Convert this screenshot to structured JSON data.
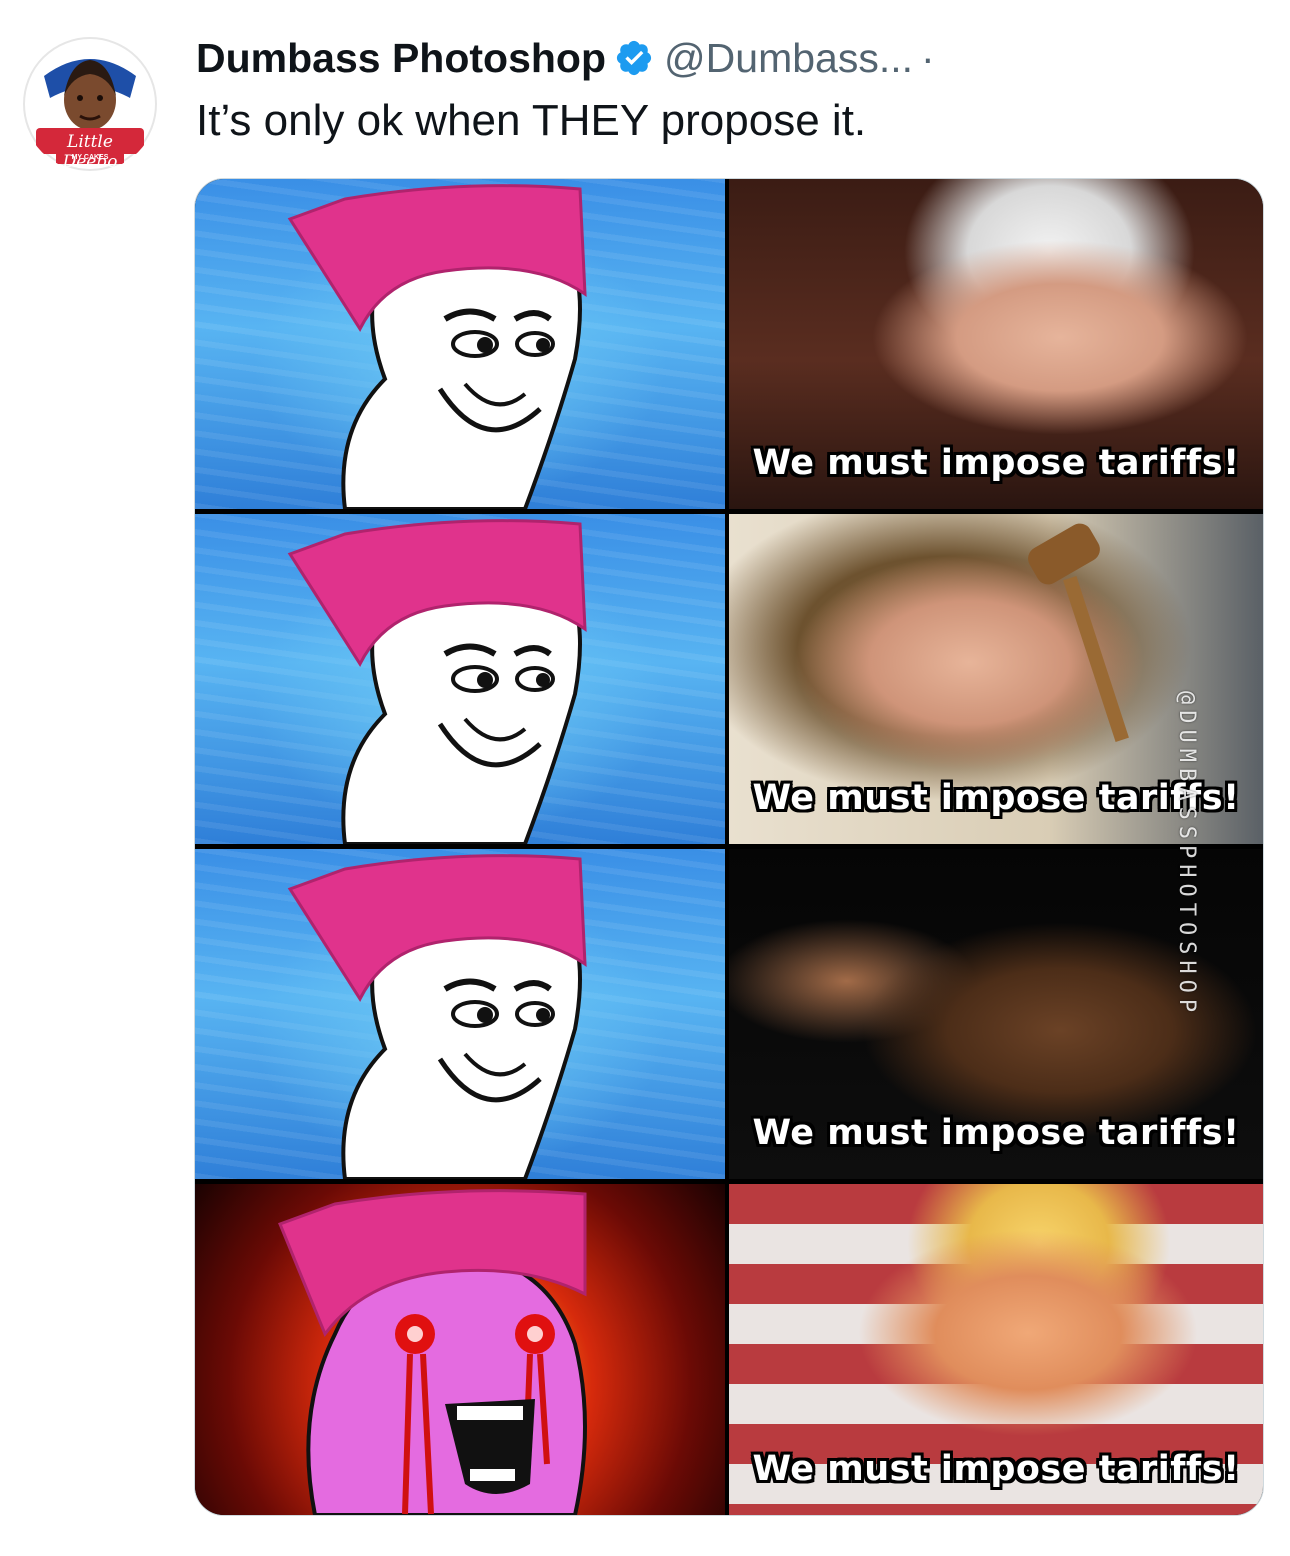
{
  "tweet": {
    "author_name": "Dumbass Photoshop",
    "handle": "@Dumbass...",
    "separator": "·",
    "text": "It’s only ok when THEY propose it.",
    "avatar_label": "Little Deebo",
    "avatar_sublabel": "MY CAKES"
  },
  "meme": {
    "watermark": "@DUMBASSPHOTOSHOP",
    "captions": [
      "We must impose tariffs!",
      "We must impose tariffs!",
      "We must impose tariffs!",
      "We must impose tariffs!"
    ]
  },
  "colors": {
    "verified": "#1d9bf0",
    "hat": "#e0338c",
    "rage_face": "#e46be0"
  }
}
